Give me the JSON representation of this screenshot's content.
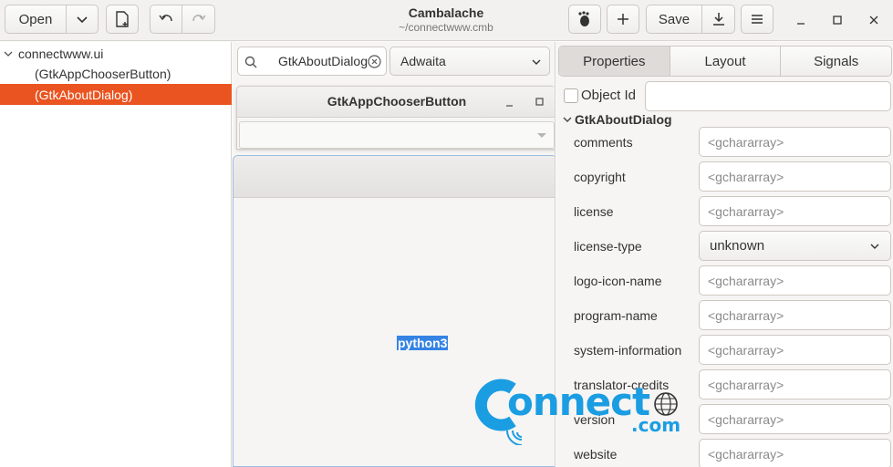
{
  "window": {
    "title": "Cambalache",
    "subtitle": "~/connectwww.cmb"
  },
  "toolbar": {
    "open_label": "Open",
    "save_label": "Save",
    "icons": [
      "chevron-down-icon",
      "new-file-icon",
      "undo-icon",
      "redo-icon",
      "gnome-icon",
      "add-icon",
      "export-icon",
      "hamburger-menu-icon",
      "minimize-icon",
      "maximize-icon",
      "close-icon"
    ]
  },
  "tree": {
    "items": [
      {
        "label": "connectwww.ui"
      },
      {
        "label": "(GtkAppChooserButton)"
      },
      {
        "label": "(GtkAboutDialog)",
        "selected": true
      }
    ]
  },
  "workspace": {
    "search_value": "GtkAboutDialog",
    "theme_value": "Adwaita",
    "window1_title": "GtkAppChooserButton",
    "window2_text": "python3"
  },
  "properties": {
    "tabs": [
      {
        "label": "Properties",
        "active": true
      },
      {
        "label": "Layout"
      },
      {
        "label": "Signals"
      }
    ],
    "object_id_label": "Object Id",
    "section_title": "GtkAboutDialog",
    "placeholder": "<gchararray>",
    "rows": [
      {
        "label": "comments",
        "kind": "entry"
      },
      {
        "label": "copyright",
        "kind": "entry"
      },
      {
        "label": "license",
        "kind": "entry"
      },
      {
        "label": "license-type",
        "kind": "combo",
        "value": "unknown"
      },
      {
        "label": "logo-icon-name",
        "kind": "entry"
      },
      {
        "label": "program-name",
        "kind": "entry"
      },
      {
        "label": "system-information",
        "kind": "entry"
      },
      {
        "label": "translator-credits",
        "kind": "entry"
      },
      {
        "label": "version",
        "kind": "entry"
      },
      {
        "label": "website",
        "kind": "entry"
      }
    ]
  },
  "watermark": {
    "text": "onnect",
    "suffix": ".com"
  },
  "colors": {
    "selection": "#e95420",
    "watermark": "#1b9de2",
    "highlight": "#3584e4"
  }
}
